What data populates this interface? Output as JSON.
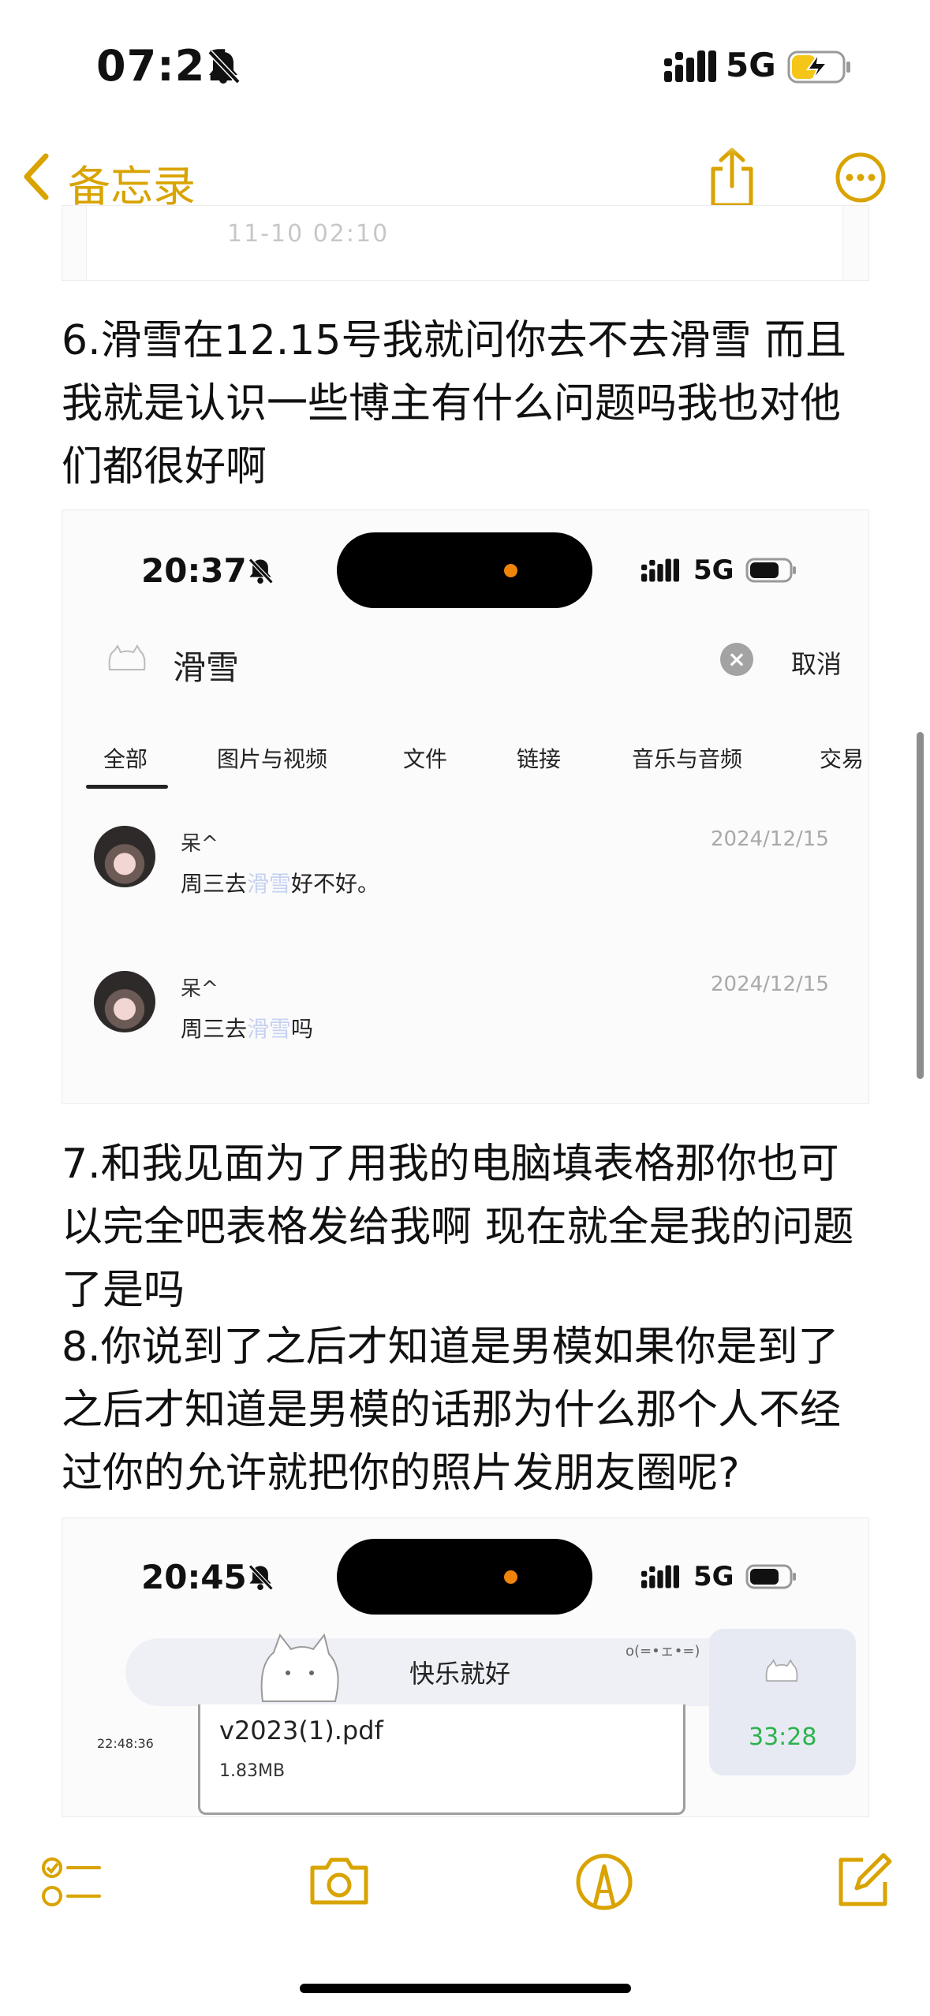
{
  "status_bar": {
    "time": "07:21",
    "network": "5G",
    "bell_icon": "bell-slash-icon",
    "battery_icon": "battery-charging-icon"
  },
  "nav": {
    "back_label": "备忘录",
    "back_icon": "chevron-left-icon",
    "share_icon": "share-icon",
    "more_icon": "more-icon",
    "accent": "#d9a300"
  },
  "screenshot0": {
    "timestamp": "11-10 02:10"
  },
  "note": {
    "para6": "6.滑雪在12.15号我就问你去不去滑雪 而且我就是认识一些博主有什么问题吗我也对他们都很好啊",
    "para7": "7.和我见面为了用我的电脑填表格那你也可以完全吧表格发给我啊 现在就全是我的问题了是吗",
    "para8": "8.你说到了之后才知道是男模如果你是到了之后才知道是男模的话那为什么那个人不经过你的允许就把你的照片发朋友圈呢?"
  },
  "screenshot1": {
    "time": "20:37",
    "network": "5G",
    "search_query": "滑雪",
    "cancel_label": "取消",
    "tabs": [
      "全部",
      "图片与视频",
      "文件",
      "链接",
      "音乐与音频",
      "交易"
    ],
    "results": [
      {
        "name": "呆^",
        "date": "2024/12/15",
        "pre": "周三去",
        "hl": "滑雪",
        "post": "好不好。"
      },
      {
        "name": "呆^",
        "date": "2024/12/15",
        "pre": "周三去",
        "hl": "滑雪",
        "post": "吗"
      }
    ]
  },
  "screenshot2": {
    "time": "20:45",
    "network": "5G",
    "banner_text": "快乐就好",
    "emoticon": "o(=•ェ•=)",
    "msg_time": "22:48:36",
    "file_name": "v2023(1).pdf",
    "file_size": "1.83MB",
    "call_timer": "33:28",
    "timer_color": "#2bb24c"
  },
  "toolbar": {
    "checklist_icon": "checklist-icon",
    "camera_icon": "camera-icon",
    "markup_icon": "markup-pen-icon",
    "compose_icon": "compose-icon"
  }
}
